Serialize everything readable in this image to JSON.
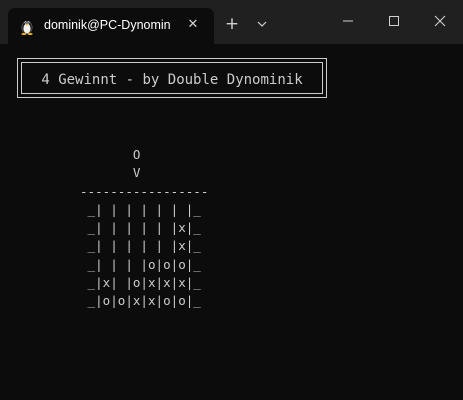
{
  "titlebar": {
    "tab_title": "dominik@PC-Dynomin",
    "tab_icon": "linux-penguin-icon"
  },
  "terminal": {
    "banner_text": "4 Gewinnt - by Double Dynominik",
    "board_lines": [
      "       O",
      "       V",
      "-----------------",
      " _| | | | | | |_",
      " _| | | | | |x|_",
      " _| | | | | |x|_",
      " _| | | |o|o|o|_",
      " _|x| |o|x|x|x|_",
      " _|o|o|x|x|o|o|_"
    ]
  },
  "colors": {
    "background": "#0c0c0c",
    "titlebar": "#202020",
    "text": "#cccccc"
  }
}
